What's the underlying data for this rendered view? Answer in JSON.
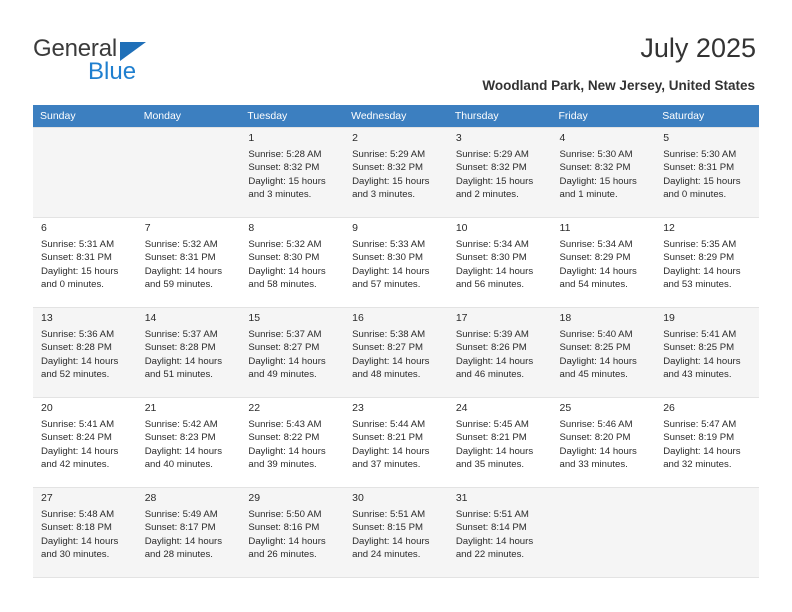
{
  "brand": {
    "word_one": "General",
    "word_two": "Blue",
    "color_blue": "#1f7fcf",
    "color_triangle": "#1f6fb8"
  },
  "header": {
    "title": "July 2025",
    "subtitle": "Woodland Park, New Jersey, United States"
  },
  "calendar": {
    "header_bg": "#3c7fc0",
    "weekdays": [
      "Sunday",
      "Monday",
      "Tuesday",
      "Wednesday",
      "Thursday",
      "Friday",
      "Saturday"
    ],
    "labels": {
      "sunrise": "Sunrise:",
      "sunset": "Sunset:",
      "daylight": "Daylight:"
    },
    "weeks": [
      [
        {
          "day": "",
          "sunrise": "",
          "sunset": "",
          "daylight": ""
        },
        {
          "day": "",
          "sunrise": "",
          "sunset": "",
          "daylight": ""
        },
        {
          "day": "1",
          "sunrise": "Sunrise: 5:28 AM",
          "sunset": "Sunset: 8:32 PM",
          "daylight": "Daylight: 15 hours and 3 minutes."
        },
        {
          "day": "2",
          "sunrise": "Sunrise: 5:29 AM",
          "sunset": "Sunset: 8:32 PM",
          "daylight": "Daylight: 15 hours and 3 minutes."
        },
        {
          "day": "3",
          "sunrise": "Sunrise: 5:29 AM",
          "sunset": "Sunset: 8:32 PM",
          "daylight": "Daylight: 15 hours and 2 minutes."
        },
        {
          "day": "4",
          "sunrise": "Sunrise: 5:30 AM",
          "sunset": "Sunset: 8:32 PM",
          "daylight": "Daylight: 15 hours and 1 minute."
        },
        {
          "day": "5",
          "sunrise": "Sunrise: 5:30 AM",
          "sunset": "Sunset: 8:31 PM",
          "daylight": "Daylight: 15 hours and 0 minutes."
        }
      ],
      [
        {
          "day": "6",
          "sunrise": "Sunrise: 5:31 AM",
          "sunset": "Sunset: 8:31 PM",
          "daylight": "Daylight: 15 hours and 0 minutes."
        },
        {
          "day": "7",
          "sunrise": "Sunrise: 5:32 AM",
          "sunset": "Sunset: 8:31 PM",
          "daylight": "Daylight: 14 hours and 59 minutes."
        },
        {
          "day": "8",
          "sunrise": "Sunrise: 5:32 AM",
          "sunset": "Sunset: 8:30 PM",
          "daylight": "Daylight: 14 hours and 58 minutes."
        },
        {
          "day": "9",
          "sunrise": "Sunrise: 5:33 AM",
          "sunset": "Sunset: 8:30 PM",
          "daylight": "Daylight: 14 hours and 57 minutes."
        },
        {
          "day": "10",
          "sunrise": "Sunrise: 5:34 AM",
          "sunset": "Sunset: 8:30 PM",
          "daylight": "Daylight: 14 hours and 56 minutes."
        },
        {
          "day": "11",
          "sunrise": "Sunrise: 5:34 AM",
          "sunset": "Sunset: 8:29 PM",
          "daylight": "Daylight: 14 hours and 54 minutes."
        },
        {
          "day": "12",
          "sunrise": "Sunrise: 5:35 AM",
          "sunset": "Sunset: 8:29 PM",
          "daylight": "Daylight: 14 hours and 53 minutes."
        }
      ],
      [
        {
          "day": "13",
          "sunrise": "Sunrise: 5:36 AM",
          "sunset": "Sunset: 8:28 PM",
          "daylight": "Daylight: 14 hours and 52 minutes."
        },
        {
          "day": "14",
          "sunrise": "Sunrise: 5:37 AM",
          "sunset": "Sunset: 8:28 PM",
          "daylight": "Daylight: 14 hours and 51 minutes."
        },
        {
          "day": "15",
          "sunrise": "Sunrise: 5:37 AM",
          "sunset": "Sunset: 8:27 PM",
          "daylight": "Daylight: 14 hours and 49 minutes."
        },
        {
          "day": "16",
          "sunrise": "Sunrise: 5:38 AM",
          "sunset": "Sunset: 8:27 PM",
          "daylight": "Daylight: 14 hours and 48 minutes."
        },
        {
          "day": "17",
          "sunrise": "Sunrise: 5:39 AM",
          "sunset": "Sunset: 8:26 PM",
          "daylight": "Daylight: 14 hours and 46 minutes."
        },
        {
          "day": "18",
          "sunrise": "Sunrise: 5:40 AM",
          "sunset": "Sunset: 8:25 PM",
          "daylight": "Daylight: 14 hours and 45 minutes."
        },
        {
          "day": "19",
          "sunrise": "Sunrise: 5:41 AM",
          "sunset": "Sunset: 8:25 PM",
          "daylight": "Daylight: 14 hours and 43 minutes."
        }
      ],
      [
        {
          "day": "20",
          "sunrise": "Sunrise: 5:41 AM",
          "sunset": "Sunset: 8:24 PM",
          "daylight": "Daylight: 14 hours and 42 minutes."
        },
        {
          "day": "21",
          "sunrise": "Sunrise: 5:42 AM",
          "sunset": "Sunset: 8:23 PM",
          "daylight": "Daylight: 14 hours and 40 minutes."
        },
        {
          "day": "22",
          "sunrise": "Sunrise: 5:43 AM",
          "sunset": "Sunset: 8:22 PM",
          "daylight": "Daylight: 14 hours and 39 minutes."
        },
        {
          "day": "23",
          "sunrise": "Sunrise: 5:44 AM",
          "sunset": "Sunset: 8:21 PM",
          "daylight": "Daylight: 14 hours and 37 minutes."
        },
        {
          "day": "24",
          "sunrise": "Sunrise: 5:45 AM",
          "sunset": "Sunset: 8:21 PM",
          "daylight": "Daylight: 14 hours and 35 minutes."
        },
        {
          "day": "25",
          "sunrise": "Sunrise: 5:46 AM",
          "sunset": "Sunset: 8:20 PM",
          "daylight": "Daylight: 14 hours and 33 minutes."
        },
        {
          "day": "26",
          "sunrise": "Sunrise: 5:47 AM",
          "sunset": "Sunset: 8:19 PM",
          "daylight": "Daylight: 14 hours and 32 minutes."
        }
      ],
      [
        {
          "day": "27",
          "sunrise": "Sunrise: 5:48 AM",
          "sunset": "Sunset: 8:18 PM",
          "daylight": "Daylight: 14 hours and 30 minutes."
        },
        {
          "day": "28",
          "sunrise": "Sunrise: 5:49 AM",
          "sunset": "Sunset: 8:17 PM",
          "daylight": "Daylight: 14 hours and 28 minutes."
        },
        {
          "day": "29",
          "sunrise": "Sunrise: 5:50 AM",
          "sunset": "Sunset: 8:16 PM",
          "daylight": "Daylight: 14 hours and 26 minutes."
        },
        {
          "day": "30",
          "sunrise": "Sunrise: 5:51 AM",
          "sunset": "Sunset: 8:15 PM",
          "daylight": "Daylight: 14 hours and 24 minutes."
        },
        {
          "day": "31",
          "sunrise": "Sunrise: 5:51 AM",
          "sunset": "Sunset: 8:14 PM",
          "daylight": "Daylight: 14 hours and 22 minutes."
        },
        {
          "day": "",
          "sunrise": "",
          "sunset": "",
          "daylight": ""
        },
        {
          "day": "",
          "sunrise": "",
          "sunset": "",
          "daylight": ""
        }
      ]
    ]
  }
}
